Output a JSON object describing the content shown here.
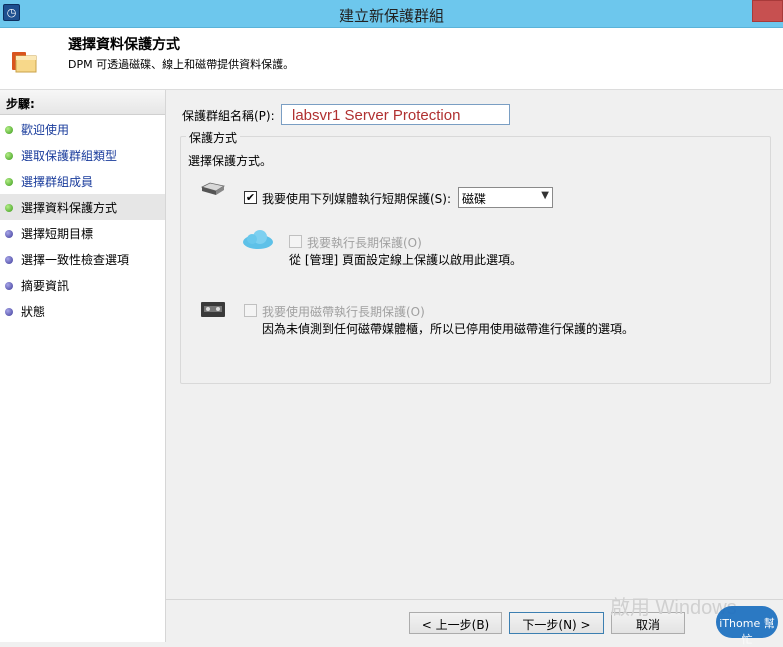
{
  "window": {
    "title": "建立新保護群組"
  },
  "header": {
    "title": "選擇資料保護方式",
    "subtitle": "DPM 可透過磁碟、線上和磁帶提供資料保護。"
  },
  "sidebar": {
    "heading": "步驟:",
    "items": [
      {
        "label": "歡迎使用",
        "state": "done"
      },
      {
        "label": "選取保護群組類型",
        "state": "done"
      },
      {
        "label": "選擇群組成員",
        "state": "done"
      },
      {
        "label": "選擇資料保護方式",
        "state": "current"
      },
      {
        "label": "選擇短期目標",
        "state": "todo"
      },
      {
        "label": "選擇一致性檢查選項",
        "state": "todo"
      },
      {
        "label": "摘要資訊",
        "state": "todo"
      },
      {
        "label": "狀態",
        "state": "todo"
      }
    ]
  },
  "form": {
    "group_name_label": "保護群組名稱(P):",
    "group_name_value": "labsvr1  Server Protection",
    "protection_groupbox_title": "保護方式",
    "protection_desc": "選擇保護方式。",
    "short_term": {
      "label": "我要使用下列媒體執行短期保護(S):",
      "checked": true,
      "media_selected": "磁碟"
    },
    "online_long_term": {
      "label": "我要執行長期保護(O)",
      "checked": false,
      "enabled": false,
      "note": "從 [管理] 頁面設定線上保護以啟用此選項。"
    },
    "tape_long_term": {
      "label": "我要使用磁帶執行長期保護(O)",
      "checked": false,
      "enabled": false,
      "note": "因為未偵測到任何磁帶媒體櫃，所以已停用使用磁帶進行保護的選項。"
    }
  },
  "buttons": {
    "back": "< 上一步(B)",
    "next": "下一步(N) >",
    "cancel": "取消"
  },
  "watermark": {
    "activate": "啟用 Windows",
    "logo_text": "iThome 幫忙"
  },
  "colors": {
    "titlebar": "#6dc7ed",
    "close_button": "#c75050",
    "link_blue": "#1a3c9c",
    "step_done": "#3a9a1a",
    "step_todo": "#3e3c9a"
  }
}
